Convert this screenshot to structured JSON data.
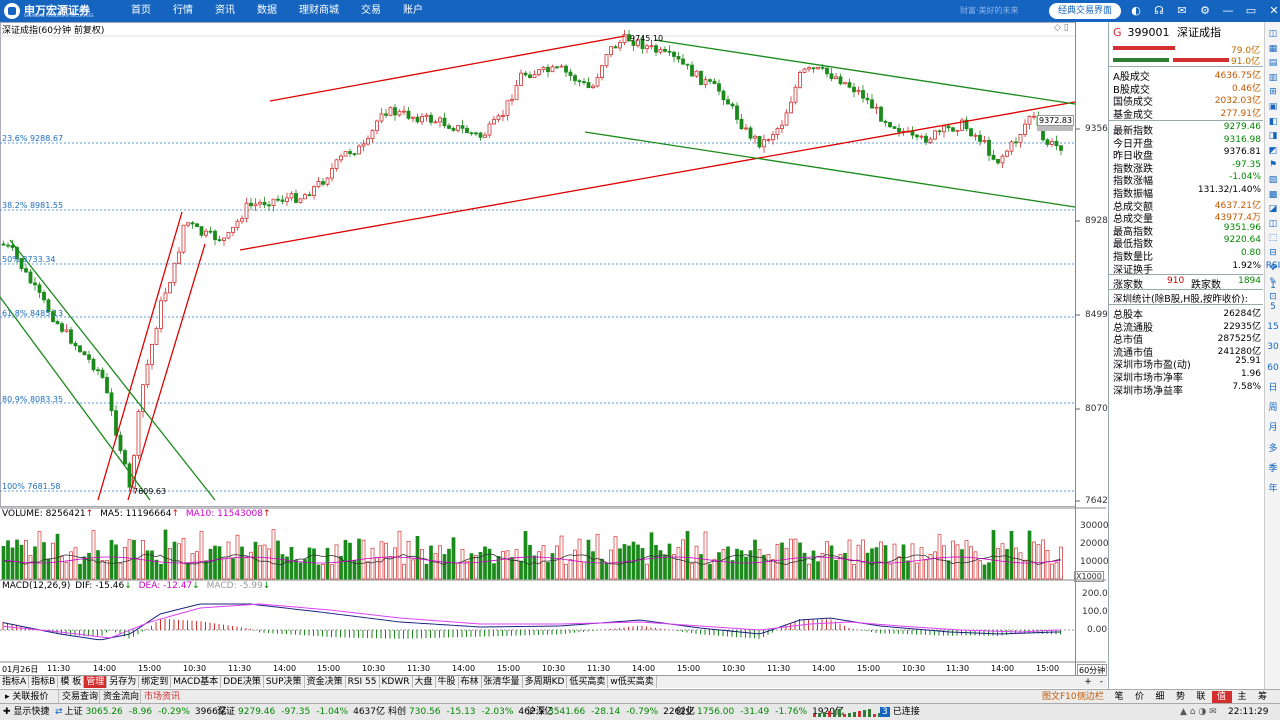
{
  "nav": {
    "logo_text": "申万宏源证券",
    "logo_sub": "SHENWAN HONGYUAN SECURITIES",
    "menu": [
      "首页",
      "行情",
      "资讯",
      "数据",
      "理财商城",
      "交易",
      "账户"
    ],
    "slogan": "财富·美好的未来",
    "classic_btn": "经典交易界面",
    "icons": [
      "contrast-icon",
      "headset-icon",
      "mail-icon",
      "gear-icon",
      "minimize-icon",
      "restore-icon",
      "close-icon"
    ]
  },
  "chart": {
    "title": "深证成指(60分钟 前复权)",
    "price_axis": [
      "9356",
      "8928",
      "8499",
      "8070",
      "7642"
    ],
    "fib_labels": [
      "23.6% 9288.67",
      "38.2% 8981.55",
      "50% 8733.34",
      "61.8% 8485.13",
      "80.9% 8083.35",
      "100% 7681.58"
    ],
    "high_label": "9745.10",
    "low_label": "7609.63",
    "current_tag": "9372.83",
    "volume_title": "VOLUME: 8256421",
    "ma5": "MA5: 11196664",
    "ma10": "MA10: 11543008",
    "volume_axis": [
      "30000",
      "20000",
      "10000"
    ],
    "volume_unit": "X1000",
    "macd_title": "MACD(12,26,9)",
    "macd_dif": "DIF: -15.46",
    "macd_dea": "DEA: -12.47",
    "macd_val": "MACD: -5.99",
    "macd_axis": [
      "200.0",
      "100.0",
      "0.00"
    ],
    "time_labels": [
      "01月26日",
      "11:30",
      "14:00",
      "15:00",
      "10:30",
      "11:30",
      "14:00",
      "15:00",
      "10:30",
      "11:30",
      "14:00",
      "15:00",
      "10:30",
      "11:30",
      "14:00",
      "15:00",
      "10:30",
      "11:30",
      "14:00",
      "15:00",
      "10:30",
      "11:30",
      "14:00",
      "15:00"
    ],
    "period_label": "60分钟"
  },
  "tabs": [
    "指标A",
    "指标B",
    "模 板",
    "管理",
    "另存为",
    "绑定到",
    "MACD基本",
    "DDE决策",
    "SUP决策",
    "资金决策",
    "RSI 55",
    "KDWR",
    "大盘",
    "牛股",
    "布林",
    "张清华量",
    "多周期KD",
    "低买高卖",
    "w低买高卖"
  ],
  "tab_ctrl": [
    "+",
    "-"
  ],
  "bottom_tabs": [
    "关联报价",
    "交易查询",
    "资金流向",
    "市场资讯"
  ],
  "bottom_side": [
    "图文F10",
    "侧边栏"
  ],
  "right_tabs": [
    "笔",
    "价",
    "细",
    "势",
    "联",
    "值",
    "主",
    "筹"
  ],
  "panel": {
    "code": "399001",
    "name": "深证成指",
    "g_tag": "G",
    "bar_up_val": "79.0亿",
    "bar_dn_val": "91.0亿",
    "group1": [
      {
        "label": "A股成交",
        "value": "4636.75亿",
        "color": "or"
      },
      {
        "label": "B股成交",
        "value": "0.46亿",
        "color": "or"
      },
      {
        "label": "国债成交",
        "value": "2032.03亿",
        "color": "or"
      },
      {
        "label": "基金成交",
        "value": "277.91亿",
        "color": "or"
      }
    ],
    "group2": [
      {
        "label": "最新指数",
        "value": "9279.46",
        "color": "dn"
      },
      {
        "label": "今日开盘",
        "value": "9316.98",
        "color": "dn"
      },
      {
        "label": "昨日收盘",
        "value": "9376.81",
        "color": "nt"
      },
      {
        "label": "指数涨跌",
        "value": "-97.35",
        "color": "dn"
      },
      {
        "label": "指数涨幅",
        "value": "-1.04%",
        "color": "dn"
      },
      {
        "label": "指数振幅",
        "value": "131.32/1.40%",
        "color": "nt"
      },
      {
        "label": "总成交额",
        "value": "4637.21亿",
        "color": "or"
      },
      {
        "label": "总成交量",
        "value": "43977.4万",
        "color": "or"
      },
      {
        "label": "最高指数",
        "value": "9351.96",
        "color": "dn"
      },
      {
        "label": "最低指数",
        "value": "9220.64",
        "color": "dn"
      },
      {
        "label": "指数量比",
        "value": "0.80",
        "color": "dn"
      },
      {
        "label": "深证换手",
        "value": "1.92%",
        "color": "nt"
      }
    ],
    "rise_label": "涨家数",
    "rise_value": "910",
    "fall_label": "跌家数",
    "fall_value": "1894",
    "stats_title": "深圳统计(除B股,H股,按昨收价):",
    "group3": [
      {
        "label": "总股本",
        "value": "26284亿",
        "color": "nt"
      },
      {
        "label": "总流通股",
        "value": "22935亿",
        "color": "nt"
      },
      {
        "label": "总市值",
        "value": "287525亿",
        "color": "nt"
      },
      {
        "label": "流通市值",
        "value": "241280亿",
        "color": "nt"
      },
      {
        "label": "深圳市场市盈(动)",
        "value": "25.91",
        "color": "nt"
      },
      {
        "label": "深圳市场市净率",
        "value": "1.96",
        "color": "nt"
      },
      {
        "label": "深圳市场净益率",
        "value": "7.58%",
        "color": "nt"
      }
    ]
  },
  "right_toolbar": [
    "RSI",
    "1",
    "5",
    "15",
    "30",
    "60",
    "日",
    "周",
    "月",
    "多",
    "季",
    "年"
  ],
  "status": {
    "show_quick": "显示快捷",
    "items": [
      {
        "name": "上证",
        "price": "3065.26",
        "chg": "-8.96",
        "pct": "-0.29%",
        "vol": "3966亿"
      },
      {
        "name": "深证",
        "price": "9279.46",
        "chg": "-97.35",
        "pct": "-1.04%",
        "vol": "4637亿"
      },
      {
        "name": "科创",
        "price": "730.56",
        "chg": "-15.13",
        "pct": "-2.03%",
        "vol": "462.5亿"
      },
      {
        "name": "沪深",
        "price": "3541.66",
        "chg": "-28.14",
        "pct": "-0.79%",
        "vol": "2262亿"
      },
      {
        "name": "创业",
        "price": "1756.00",
        "chg": "-31.49",
        "pct": "-1.76%",
        "vol": "1920亿"
      }
    ],
    "conn_num": "3",
    "conn_text": "已连接",
    "time": "22:11:29"
  }
}
